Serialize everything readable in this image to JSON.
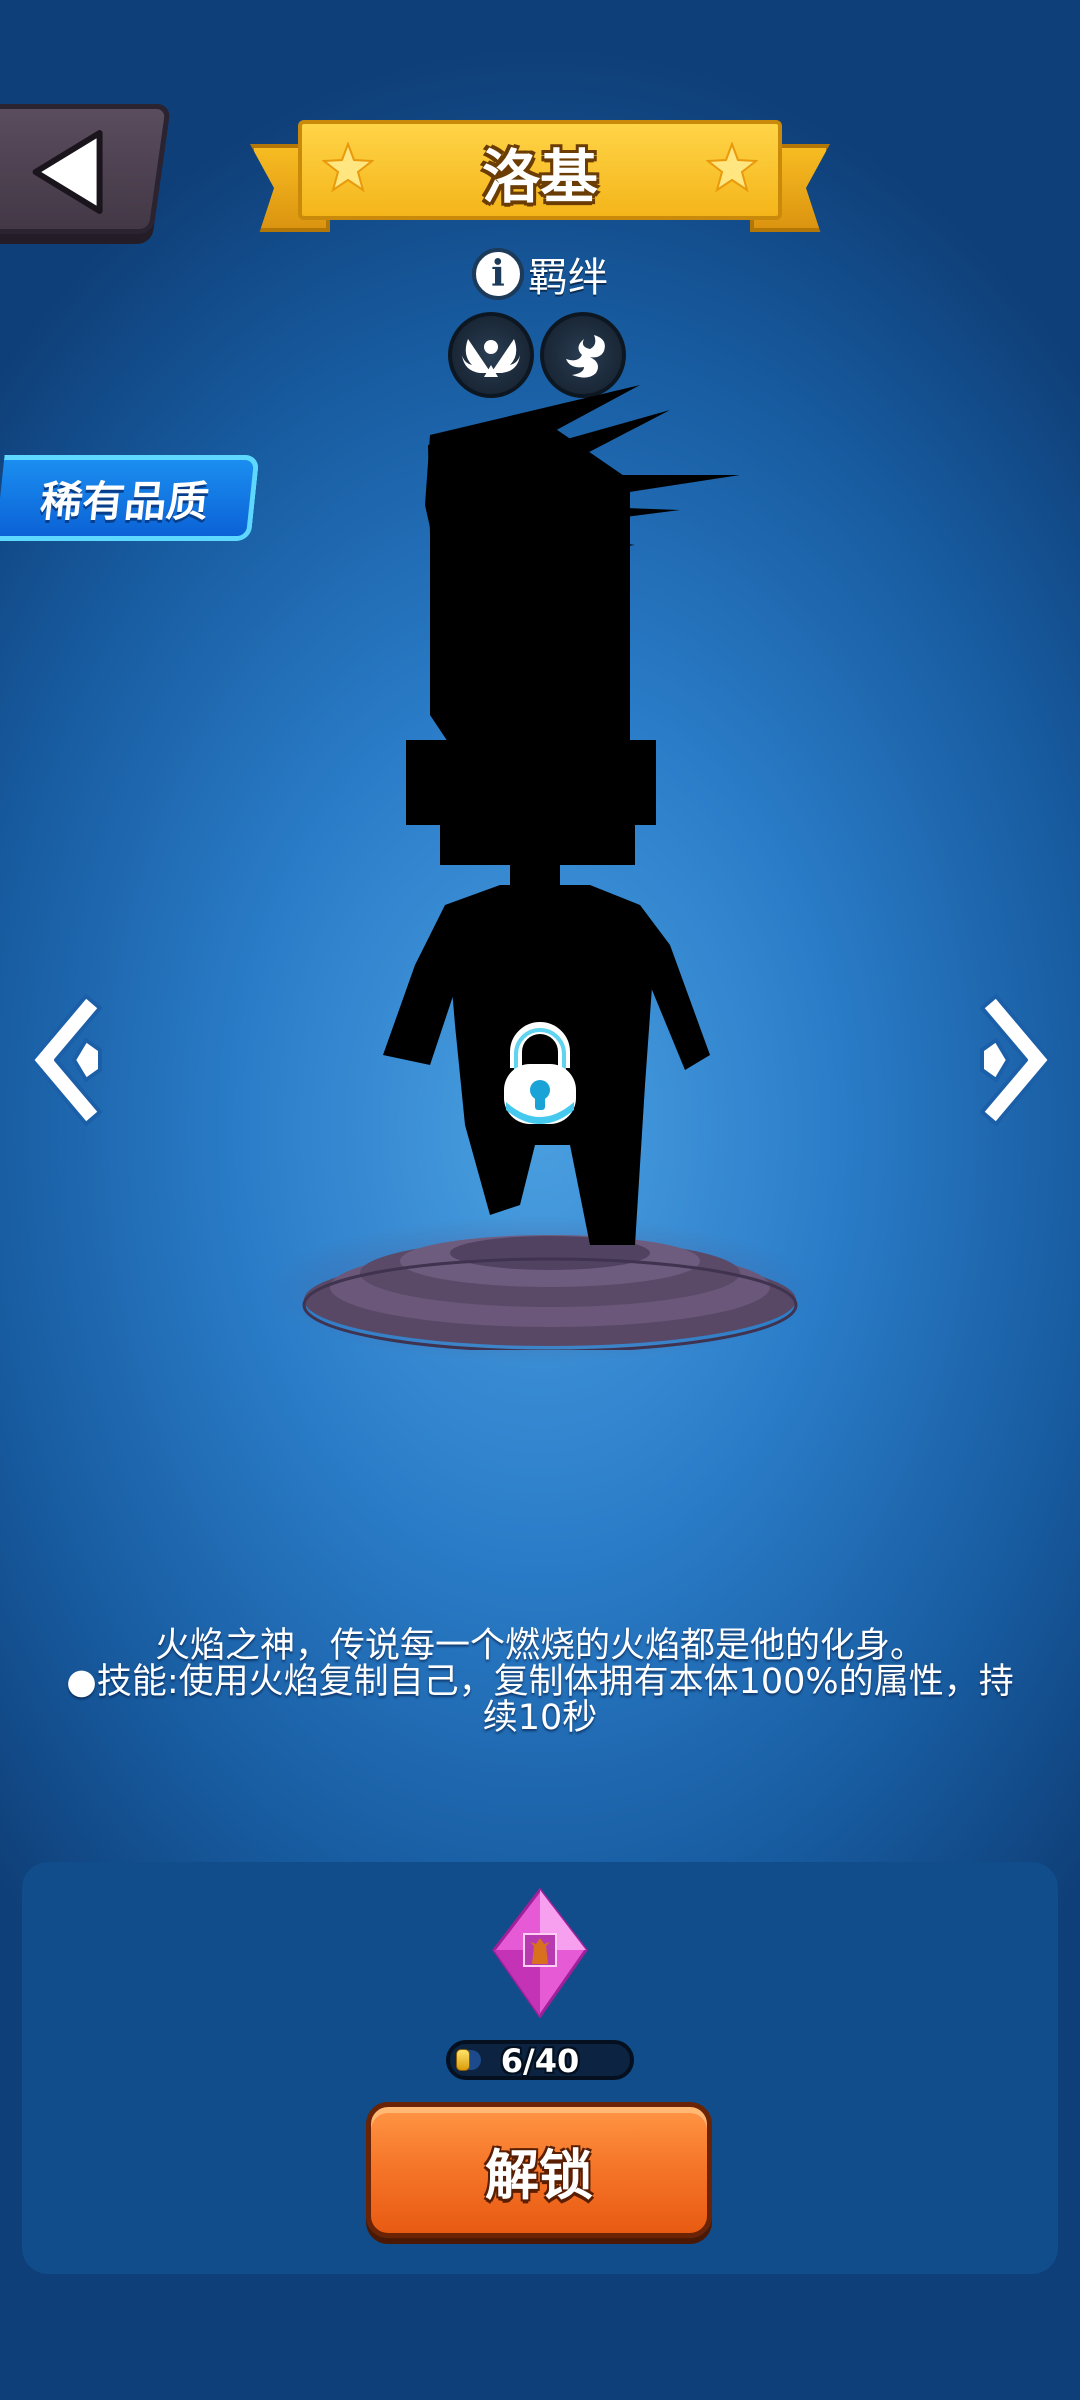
{
  "header": {
    "back_icon": "back-triangle-icon",
    "title": "洛基",
    "ribbon_color": "#ffd447"
  },
  "bond": {
    "info_icon": "info-icon",
    "label": "羁绊",
    "icons": [
      "winged-emblem-icon",
      "dragon-emblem-icon"
    ]
  },
  "rarity": {
    "label": "稀有品质",
    "color": "#1b8ef0"
  },
  "character": {
    "state": "locked",
    "lock_icon": "lock-icon"
  },
  "navigation": {
    "prev_icon": "chevron-left-icon",
    "next_icon": "chevron-right-icon"
  },
  "description": {
    "line1": "火焰之神，传说每一个燃烧的火焰都是他的化身。",
    "line2": "●技能:使用火焰复制自己，复制体拥有本体100%的属性，持",
    "line3": "续10秒"
  },
  "unlock": {
    "shard_icon": "character-shard-gem-icon",
    "progress_text": "6/40",
    "progress_current": 6,
    "progress_total": 40,
    "button_label": "解锁",
    "button_color": "#f6772a"
  }
}
